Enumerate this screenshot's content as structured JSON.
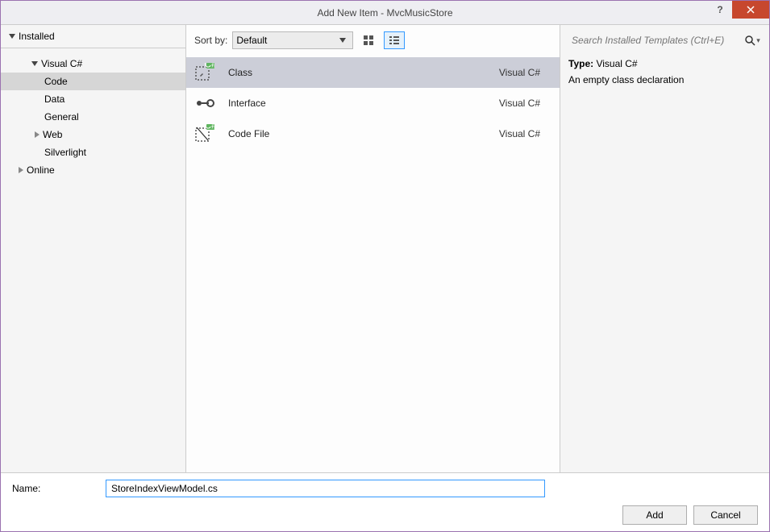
{
  "window": {
    "title": "Add New Item - MvcMusicStore"
  },
  "sidebar": {
    "header": "Installed",
    "tree": {
      "csharp": "Visual C#",
      "code": "Code",
      "data": "Data",
      "general": "General",
      "web": "Web",
      "silverlight": "Silverlight",
      "online": "Online"
    }
  },
  "toolbar": {
    "sortby_label": "Sort by:",
    "sortby_value": "Default"
  },
  "templates": [
    {
      "name": "Class",
      "lang": "Visual C#"
    },
    {
      "name": "Interface",
      "lang": "Visual C#"
    },
    {
      "name": "Code File",
      "lang": "Visual C#"
    }
  ],
  "search": {
    "placeholder": "Search Installed Templates (Ctrl+E)"
  },
  "detail": {
    "type_label": "Type:",
    "type_value": "Visual C#",
    "description": "An empty class declaration"
  },
  "footer": {
    "name_label": "Name:",
    "name_value": "StoreIndexViewModel.cs",
    "add": "Add",
    "cancel": "Cancel"
  }
}
